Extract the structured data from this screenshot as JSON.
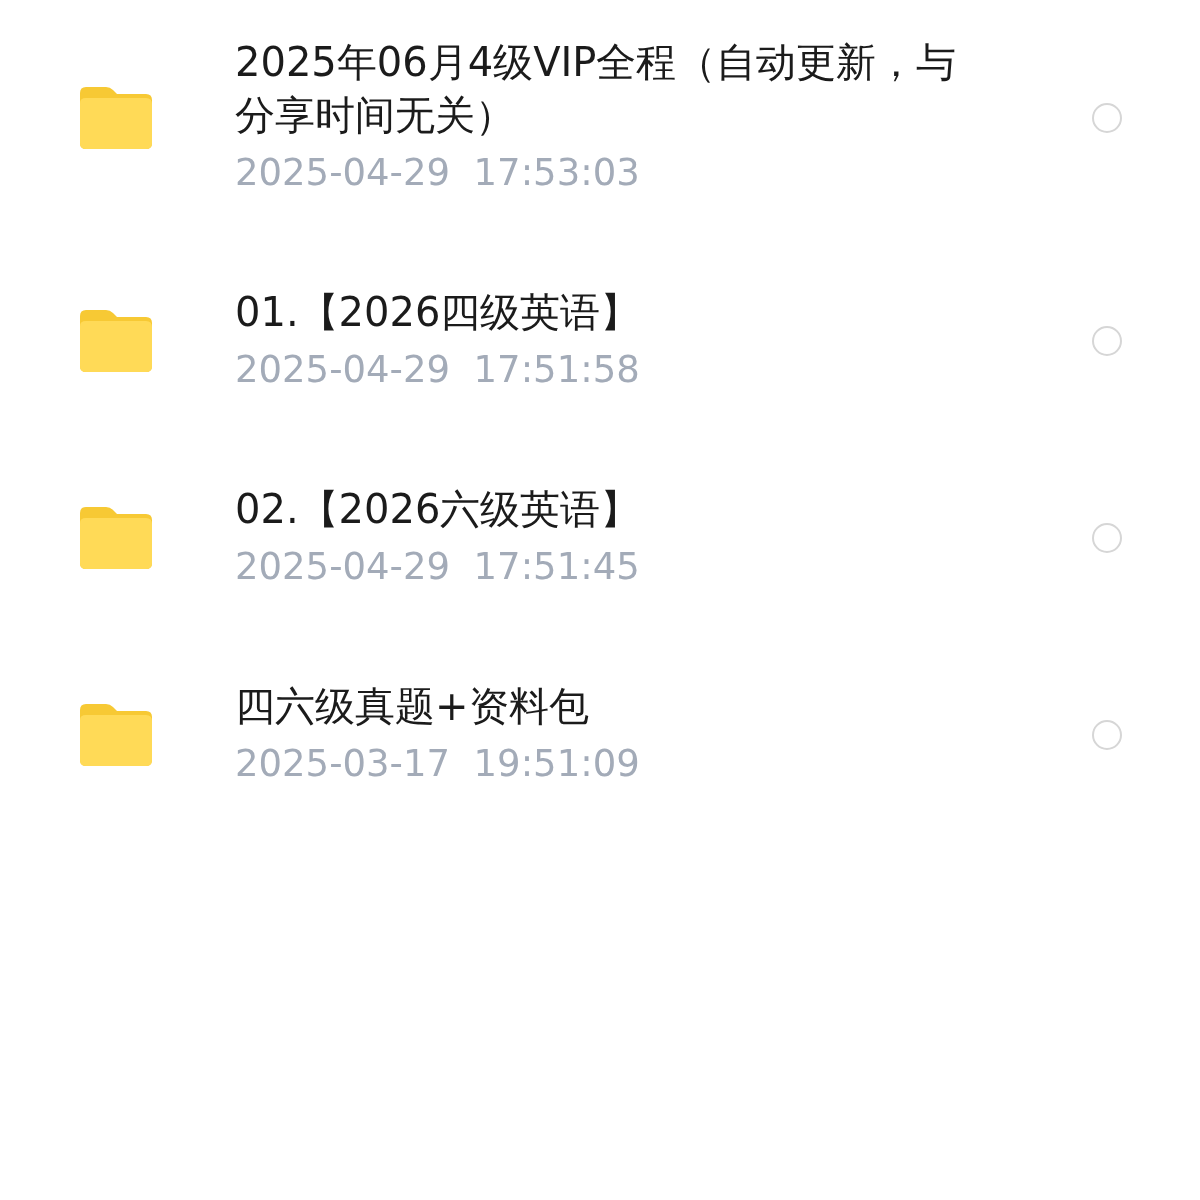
{
  "files": [
    {
      "name": "2025年06月4级VIP全程（自动更新，与分享时间无关）",
      "date": "2025-04-29  17:53:03",
      "selected": false
    },
    {
      "name": "01.【2026四级英语】",
      "date": "2025-04-29  17:51:58",
      "selected": false
    },
    {
      "name": "02.【2026六级英语】",
      "date": "2025-04-29  17:51:45",
      "selected": false
    },
    {
      "name": "四六级真题+资料包",
      "date": "2025-03-17  19:51:09",
      "selected": false
    }
  ]
}
